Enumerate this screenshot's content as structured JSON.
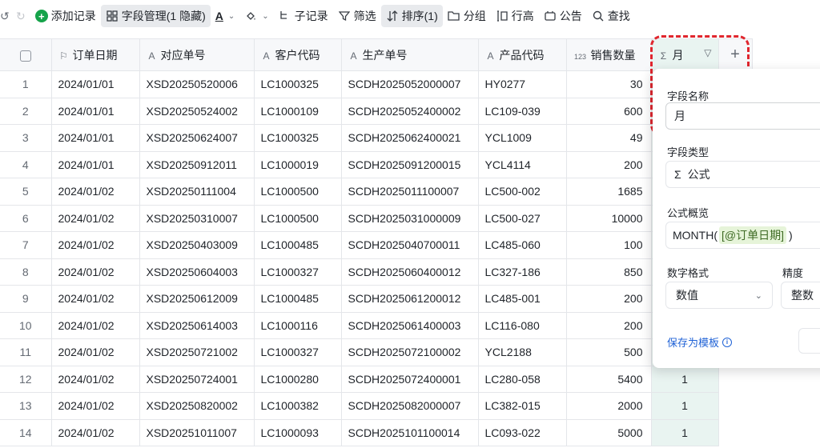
{
  "toolbar": {
    "add_record": "添加记录",
    "field_manage": "字段管理(1 隐藏)",
    "text_color_icon": "A",
    "sub_record": "子记录",
    "filter": "筛选",
    "sort": "排序(1)",
    "group": "分组",
    "row_height": "行高",
    "announcement": "公告",
    "search": "查找"
  },
  "columns": [
    {
      "label": "订单日期",
      "icon": "flag-icon",
      "glyph": "⚐"
    },
    {
      "label": "对应单号",
      "icon": "text-icon",
      "glyph": "A"
    },
    {
      "label": "客户代码",
      "icon": "text-icon",
      "glyph": "A"
    },
    {
      "label": "生产单号",
      "icon": "text-icon",
      "glyph": "A"
    },
    {
      "label": "产品代码",
      "icon": "text-icon",
      "glyph": "A"
    },
    {
      "label": "销售数量",
      "icon": "number-icon",
      "glyph": "123"
    },
    {
      "label": "月",
      "icon": "formula-icon",
      "glyph": "Σ"
    }
  ],
  "rows": [
    {
      "n": "1",
      "date": "2024/01/01",
      "order": "XSD20250520006",
      "cust": "LC1000325",
      "prod": "SCDH2025052000007",
      "code": "HY0277",
      "qty": "30",
      "month": ""
    },
    {
      "n": "2",
      "date": "2024/01/01",
      "order": "XSD20250524002",
      "cust": "LC1000109",
      "prod": "SCDH2025052400002",
      "code": "LC109-039",
      "qty": "600",
      "month": ""
    },
    {
      "n": "3",
      "date": "2024/01/01",
      "order": "XSD20250624007",
      "cust": "LC1000325",
      "prod": "SCDH2025062400021",
      "code": "YCL1009",
      "qty": "49",
      "month": ""
    },
    {
      "n": "4",
      "date": "2024/01/01",
      "order": "XSD20250912011",
      "cust": "LC1000019",
      "prod": "SCDH2025091200015",
      "code": "YCL4114",
      "qty": "200",
      "month": ""
    },
    {
      "n": "5",
      "date": "2024/01/02",
      "order": "XSD20250111004",
      "cust": "LC1000500",
      "prod": "SCDH2025011100007",
      "code": "LC500-002",
      "qty": "1685",
      "month": ""
    },
    {
      "n": "6",
      "date": "2024/01/02",
      "order": "XSD20250310007",
      "cust": "LC1000500",
      "prod": "SCDH2025031000009",
      "code": "LC500-027",
      "qty": "10000",
      "month": ""
    },
    {
      "n": "7",
      "date": "2024/01/02",
      "order": "XSD20250403009",
      "cust": "LC1000485",
      "prod": "SCDH2025040700011",
      "code": "LC485-060",
      "qty": "100",
      "month": ""
    },
    {
      "n": "8",
      "date": "2024/01/02",
      "order": "XSD20250604003",
      "cust": "LC1000327",
      "prod": "SCDH2025060400012",
      "code": "LC327-186",
      "qty": "850",
      "month": ""
    },
    {
      "n": "9",
      "date": "2024/01/02",
      "order": "XSD20250612009",
      "cust": "LC1000485",
      "prod": "SCDH2025061200012",
      "code": "LC485-001",
      "qty": "200",
      "month": ""
    },
    {
      "n": "10",
      "date": "2024/01/02",
      "order": "XSD20250614003",
      "cust": "LC1000116",
      "prod": "SCDH2025061400003",
      "code": "LC116-080",
      "qty": "200",
      "month": ""
    },
    {
      "n": "11",
      "date": "2024/01/02",
      "order": "XSD20250721002",
      "cust": "LC1000327",
      "prod": "SCDH2025072100002",
      "code": "YCL2188",
      "qty": "500",
      "month": ""
    },
    {
      "n": "12",
      "date": "2024/01/02",
      "order": "XSD20250724001",
      "cust": "LC1000280",
      "prod": "SCDH2025072400001",
      "code": "LC280-058",
      "qty": "5400",
      "month": "1"
    },
    {
      "n": "13",
      "date": "2024/01/02",
      "order": "XSD20250820002",
      "cust": "LC1000382",
      "prod": "SCDH2025082000007",
      "code": "LC382-015",
      "qty": "2000",
      "month": "1"
    },
    {
      "n": "14",
      "date": "2024/01/02",
      "order": "XSD20251011007",
      "cust": "LC1000093",
      "prod": "SCDH2025101100014",
      "code": "LC093-022",
      "qty": "5000",
      "month": "1"
    }
  ],
  "panel": {
    "field_name_label": "字段名称",
    "field_name_value": "月",
    "field_type_label": "字段类型",
    "field_type_value": "公式",
    "formula_label": "公式概览",
    "formula_func": "MONTH(",
    "formula_ref": "[@订单日期]",
    "formula_close": ")",
    "number_format_label": "数字格式",
    "number_format_value": "数值",
    "precision_label": "精度",
    "precision_value": "整数",
    "save_template": "保存为模板"
  },
  "colors": {
    "accent": "#16a34a",
    "highlight": "#e0262e",
    "formula_col_bg": "#e9f4f1",
    "link": "#1f62d6"
  }
}
